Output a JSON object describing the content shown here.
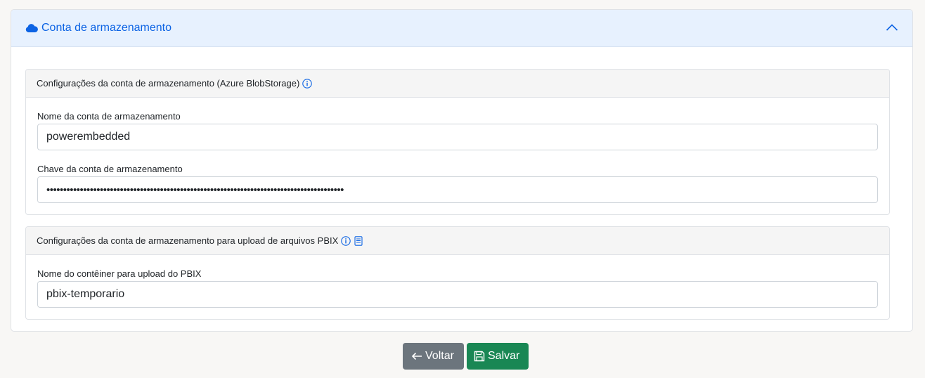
{
  "accordion": {
    "title": "Conta de armazenamento",
    "icon": "cloud-icon",
    "toggle_icon": "chevron-up-icon"
  },
  "storage_settings": {
    "title": "Configurações da conta de armazenamento (Azure BlobStorage)",
    "info_icon": "info-icon",
    "account_name": {
      "label": "Nome da conta de armazenamento",
      "value": "powerembedded"
    },
    "account_key": {
      "label": "Chave da conta de armazenamento",
      "value": "•••••••••••••••••••••••••••••••••••••••••••••••••••••••••••••••••••••••••••••••••••••••••"
    }
  },
  "pbix_settings": {
    "title": "Configurações da conta de armazenamento para upload de arquivos PBIX",
    "info_icon": "info-icon",
    "doc_icon": "document-icon",
    "container_name": {
      "label": "Nome do contêiner para upload do PBIX",
      "value": "pbix-temporario"
    }
  },
  "actions": {
    "back_label": "Voltar",
    "back_icon": "arrow-left-icon",
    "save_label": "Salvar",
    "save_icon": "floppy-disk-icon"
  },
  "colors": {
    "accent": "#0c63e4",
    "header_bg": "#e7f1fe",
    "back_button": "#6c757d",
    "save_button": "#198754"
  }
}
